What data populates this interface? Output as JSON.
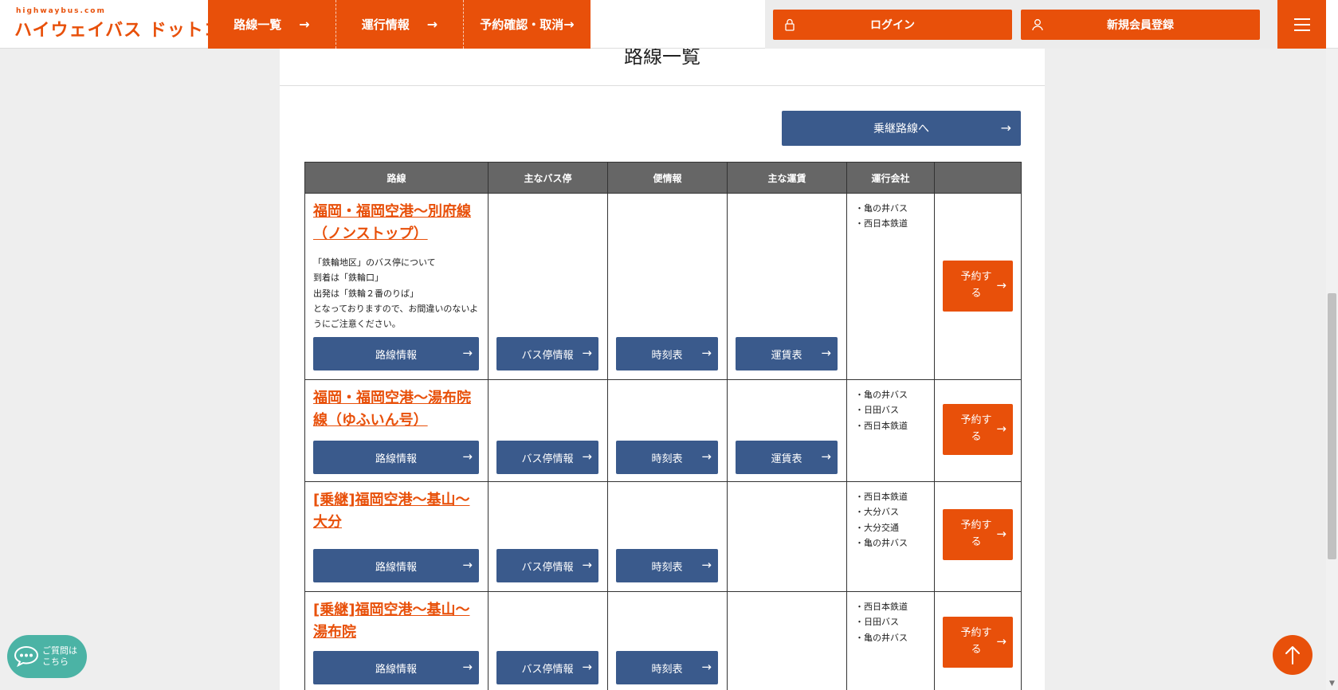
{
  "header": {
    "logo_small": "highwaybus.com",
    "logo_main": "ハイウェイバス ドットコム",
    "nav": [
      {
        "label": "路線一覧",
        "arrow": "→"
      },
      {
        "label": "運行情報",
        "arrow": "→"
      },
      {
        "label": "予約確認・取消",
        "arrow": "→"
      }
    ],
    "login_label": "ログイン",
    "register_label": "新規会員登録"
  },
  "page": {
    "title": "路線一覧",
    "transfer_label": "乗継路線へ",
    "arrow": "→"
  },
  "table": {
    "headers": [
      "路線",
      "主なバス停",
      "便情報",
      "主な運賃",
      "運行会社",
      ""
    ],
    "route_info_label": "路線情報",
    "stop_info_label": "バス停情報",
    "timetable_label": "時刻表",
    "fare_label": "運賃表",
    "reserve_label": "予約する",
    "rows": [
      {
        "name": "福岡・福岡空港～別府線（ノンストップ）",
        "note": "「鉄輪地区」のバス停について\n到着は「鉄輪口」\n出発は「鉄輪２番のりば」\nとなっておりますので、お間違いのないようにご注意ください。",
        "companies": [
          "・亀の井バス",
          "・西日本鉄道"
        ]
      },
      {
        "name": "福岡・福岡空港～湯布院線（ゆふいん号）",
        "companies": [
          "・亀の井バス",
          "・日田バス",
          "・西日本鉄道"
        ]
      },
      {
        "name": "[乗継]福岡空港～基山～大分",
        "companies": [
          "・西日本鉄道",
          "・大分バス",
          "・大分交通",
          "・亀の井バス"
        ]
      },
      {
        "name": "[乗継]福岡空港～基山～湯布院",
        "companies": [
          "・西日本鉄道",
          "・日田バス",
          "・亀の井バス"
        ]
      }
    ]
  },
  "floating": {
    "chat_label_1": "ご質問は",
    "chat_label_2": "こちら"
  },
  "scrollbar": {
    "up": "▲",
    "down": "▼"
  },
  "colors": {
    "brand_orange": "#e8500a",
    "button_blue": "#3a5a8c",
    "chat_teal": "#4bb3a5"
  }
}
